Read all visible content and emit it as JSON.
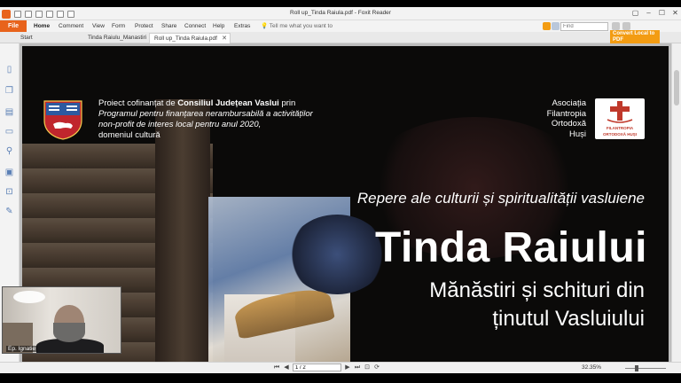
{
  "window": {
    "title": "Roll up_Tinda Raiula.pdf - Foxit Reader"
  },
  "ribbon": {
    "file": "File",
    "tabs": [
      "Home",
      "Comment",
      "View",
      "Form",
      "Protect",
      "Share",
      "Connect",
      "Help",
      "Extras"
    ],
    "tell_me": "Tell me what you want to",
    "find_placeholder": "Find",
    "convert": "Convert Local to PDF"
  },
  "doc_tabs": [
    "Start",
    "Tinda Raiulu_Manastiri ...",
    "Roll up_Tinda Raiula.pdf"
  ],
  "page": {
    "project_line1_a": "Proiect cofinanțat de ",
    "project_line1_b": "Consiliul Județean Vaslui",
    "project_line1_c": " prin",
    "project_line2": "Programul pentru finanțarea nerambursabilă a activităților",
    "project_line3": "non-profit de interes local pentru anul 2020,",
    "project_line4": "domeniul cultură",
    "assoc": [
      "Asociația",
      "Filantropia",
      "Ortodoxă",
      "Huși"
    ],
    "logo_top": "FILANTROPIA",
    "logo_bottom": "ORTODOXĂ HUȘI",
    "subtitle": "Repere ale culturii și spiritualității vasluiene",
    "title": "Tinda Raiului",
    "line1": "Mănăstiri și schituri din",
    "line2": "ținutul Vasluiului"
  },
  "webcam": {
    "label": "Ep. Ignatie"
  },
  "status": {
    "page_field": "1 / 2",
    "zoom": "32.35%"
  },
  "colors": {
    "accent": "#e8631c",
    "convert": "#f39c12"
  }
}
